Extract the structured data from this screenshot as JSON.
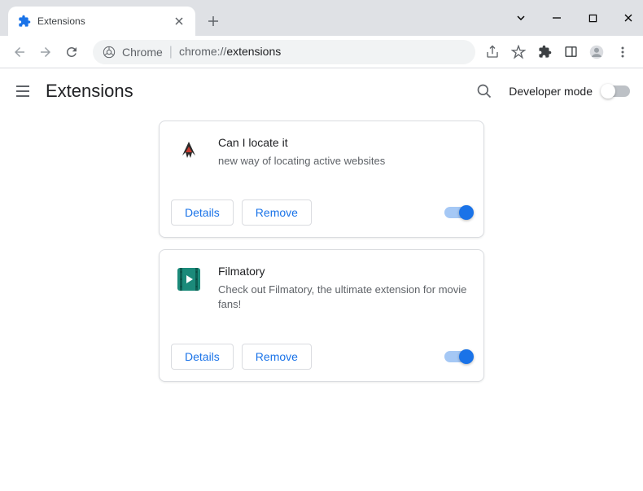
{
  "tab": {
    "title": "Extensions"
  },
  "omnibox": {
    "origin": "Chrome",
    "url_prefix": "chrome://",
    "url_path": "extensions"
  },
  "page": {
    "title": "Extensions",
    "dev_mode_label": "Developer mode"
  },
  "buttons": {
    "details": "Details",
    "remove": "Remove"
  },
  "extensions": [
    {
      "name": "Can I locate it",
      "description": "new way of locating active websites",
      "enabled": true,
      "icon": "bird"
    },
    {
      "name": "Filmatory",
      "description": "Check out Filmatory, the ultimate extension for movie fans!",
      "enabled": true,
      "icon": "film"
    }
  ]
}
